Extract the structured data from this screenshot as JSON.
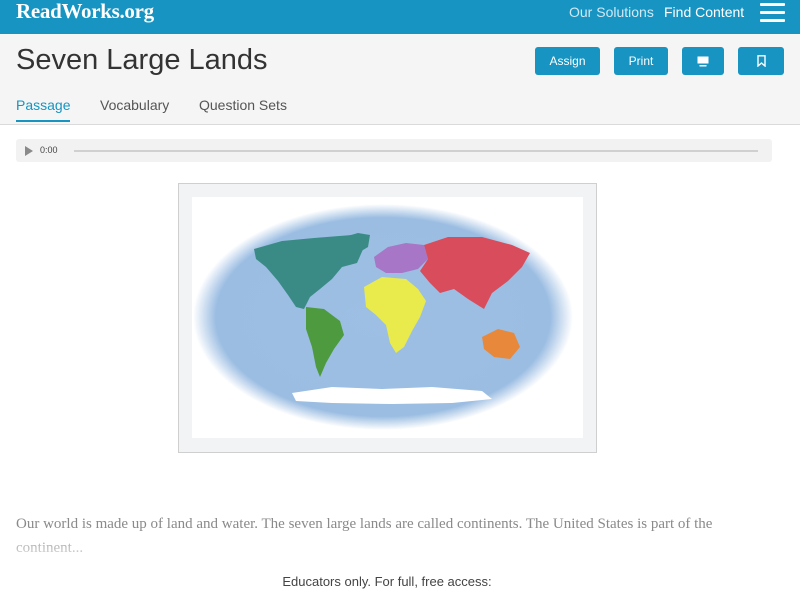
{
  "topbar": {
    "logo": "ReadWorks.org",
    "nav": {
      "solutions": "Our Solutions",
      "find_content": "Find Content"
    },
    "menu_icon": "hamburger-menu-icon",
    "color": "#1794c1"
  },
  "header": {
    "title": "Seven Large Lands",
    "buttons": {
      "assign": "Assign",
      "print": "Print",
      "present_icon": "monitor-icon",
      "bookmark_icon": "bookmark-icon"
    },
    "tabs": [
      {
        "label": "Passage",
        "active": true
      },
      {
        "label": "Vocabulary",
        "active": false
      },
      {
        "label": "Question Sets",
        "active": false
      }
    ]
  },
  "audio": {
    "time": "0:00",
    "progress": 0,
    "icon": "play-icon"
  },
  "figure": {
    "image": "world-continents-map"
  },
  "passage": {
    "text": "Our world is made up of land and water. The seven large lands are called continents. The United States is part of the continent..."
  },
  "footer": {
    "educators": "Educators only. For full, free access:"
  }
}
